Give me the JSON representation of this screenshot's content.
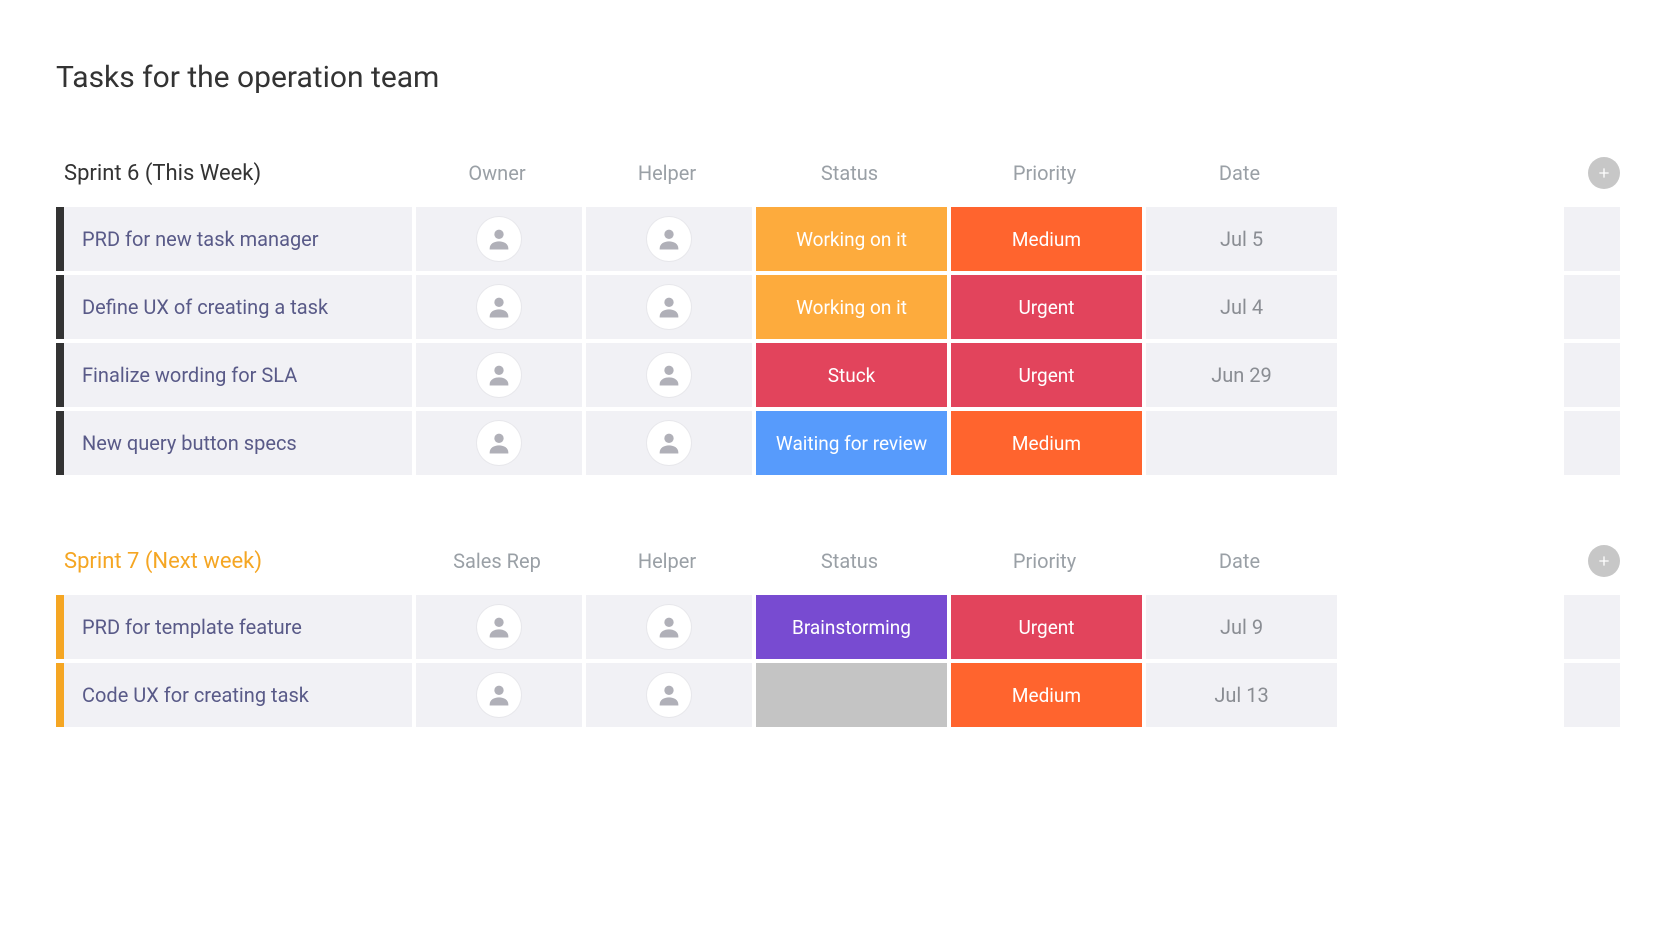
{
  "title": "Tasks for the operation team",
  "colors": {
    "working_on_it": "#fdab3d",
    "stuck": "#e2445c",
    "waiting_for_review": "#579bfc",
    "brainstorming": "#784bd1",
    "empty_status": "#c4c4c4",
    "priority_urgent": "#e2445c",
    "priority_medium": "#ff642e",
    "row_bg": "#f1f1f5"
  },
  "groups": [
    {
      "title": "Sprint 6 (This Week)",
      "accent": "dark",
      "columns": [
        "Owner",
        "Helper",
        "Status",
        "Priority",
        "Date"
      ],
      "rows": [
        {
          "name": "PRD for new task manager",
          "owner": "person-a",
          "helper": "person-b",
          "status": {
            "label": "Working on it",
            "colorKey": "working_on_it"
          },
          "priority": {
            "label": "Medium",
            "colorKey": "priority_medium"
          },
          "date": "Jul 5"
        },
        {
          "name": "Define UX of creating a task",
          "owner": "person-c",
          "helper": "person-d",
          "status": {
            "label": "Working on it",
            "colorKey": "working_on_it"
          },
          "priority": {
            "label": "Urgent",
            "colorKey": "priority_urgent"
          },
          "date": "Jul 4"
        },
        {
          "name": "Finalize wording for SLA",
          "owner": "person-c",
          "helper": "person-b",
          "status": {
            "label": "Stuck",
            "colorKey": "stuck"
          },
          "priority": {
            "label": "Urgent",
            "colorKey": "priority_urgent"
          },
          "date": "Jun 29"
        },
        {
          "name": "New query button specs",
          "owner": "person-b",
          "helper": "person-c",
          "status": {
            "label": "Waiting for review",
            "colorKey": "waiting_for_review"
          },
          "priority": {
            "label": "Medium",
            "colorKey": "priority_medium"
          },
          "date": ""
        }
      ]
    },
    {
      "title": "Sprint 7 (Next week)",
      "accent": "orange",
      "columns": [
        "Sales Rep",
        "Helper",
        "Status",
        "Priority",
        "Date"
      ],
      "rows": [
        {
          "name": "PRD for template feature",
          "owner": "person-b",
          "helper": "person-d",
          "status": {
            "label": "Brainstorming",
            "colorKey": "brainstorming"
          },
          "priority": {
            "label": "Urgent",
            "colorKey": "priority_urgent"
          },
          "date": "Jul 9"
        },
        {
          "name": "Code UX for creating task",
          "owner": "person-d",
          "helper": "person-c",
          "status": {
            "label": "",
            "colorKey": "empty_status"
          },
          "priority": {
            "label": "Medium",
            "colorKey": "priority_medium"
          },
          "date": "Jul 13"
        }
      ]
    }
  ]
}
